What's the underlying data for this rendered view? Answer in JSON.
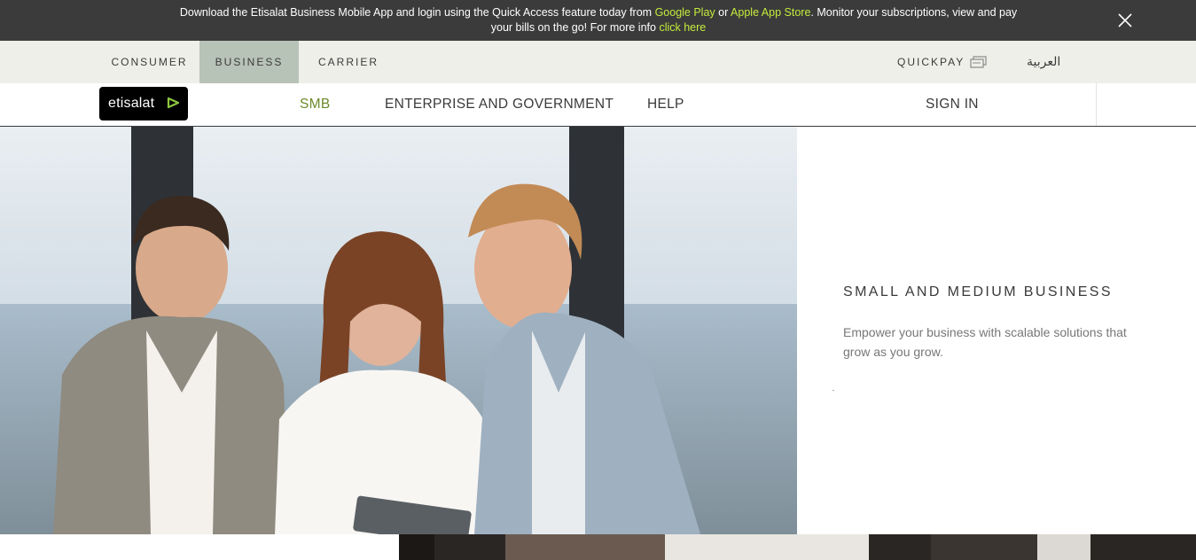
{
  "banner": {
    "text_before": "Download the Etisalat Business Mobile App and login using the Quick Access feature today from ",
    "google_play": "Google Play",
    "or": " or ",
    "apple_store": "Apple App Store",
    "text_after": ". Monitor your subscriptions, view and pay your bills on the go! For more info ",
    "click_here": "click here",
    "close_icon": "close-icon"
  },
  "segments": {
    "items": [
      {
        "label": "CONSUMER",
        "active": false
      },
      {
        "label": "BUSINESS",
        "active": true
      },
      {
        "label": "CARRIER",
        "active": false
      }
    ],
    "quickpay": "QUICKPAY",
    "quickpay_icon": "card-icon",
    "arabic": "العربية"
  },
  "nav": {
    "logo": "etisalat",
    "items": [
      {
        "label": "SMB",
        "active": true
      },
      {
        "label": "ENTERPRISE AND GOVERNMENT",
        "active": false
      },
      {
        "label": "HELP",
        "active": false
      }
    ],
    "sign_in": "SIGN IN"
  },
  "hero": {
    "title": "SMALL AND MEDIUM BUSINESS",
    "description": "Empower your business with scalable solutions that grow as you grow.",
    "image": "three business people looking at a tablet"
  },
  "colors": {
    "banner_bg": "#3b3b3b",
    "banner_link": "#c5ec3c",
    "segment_bar_bg": "#efefea",
    "segment_active_bg": "#b8c3b7",
    "nav_active": "#6b8a2a"
  }
}
